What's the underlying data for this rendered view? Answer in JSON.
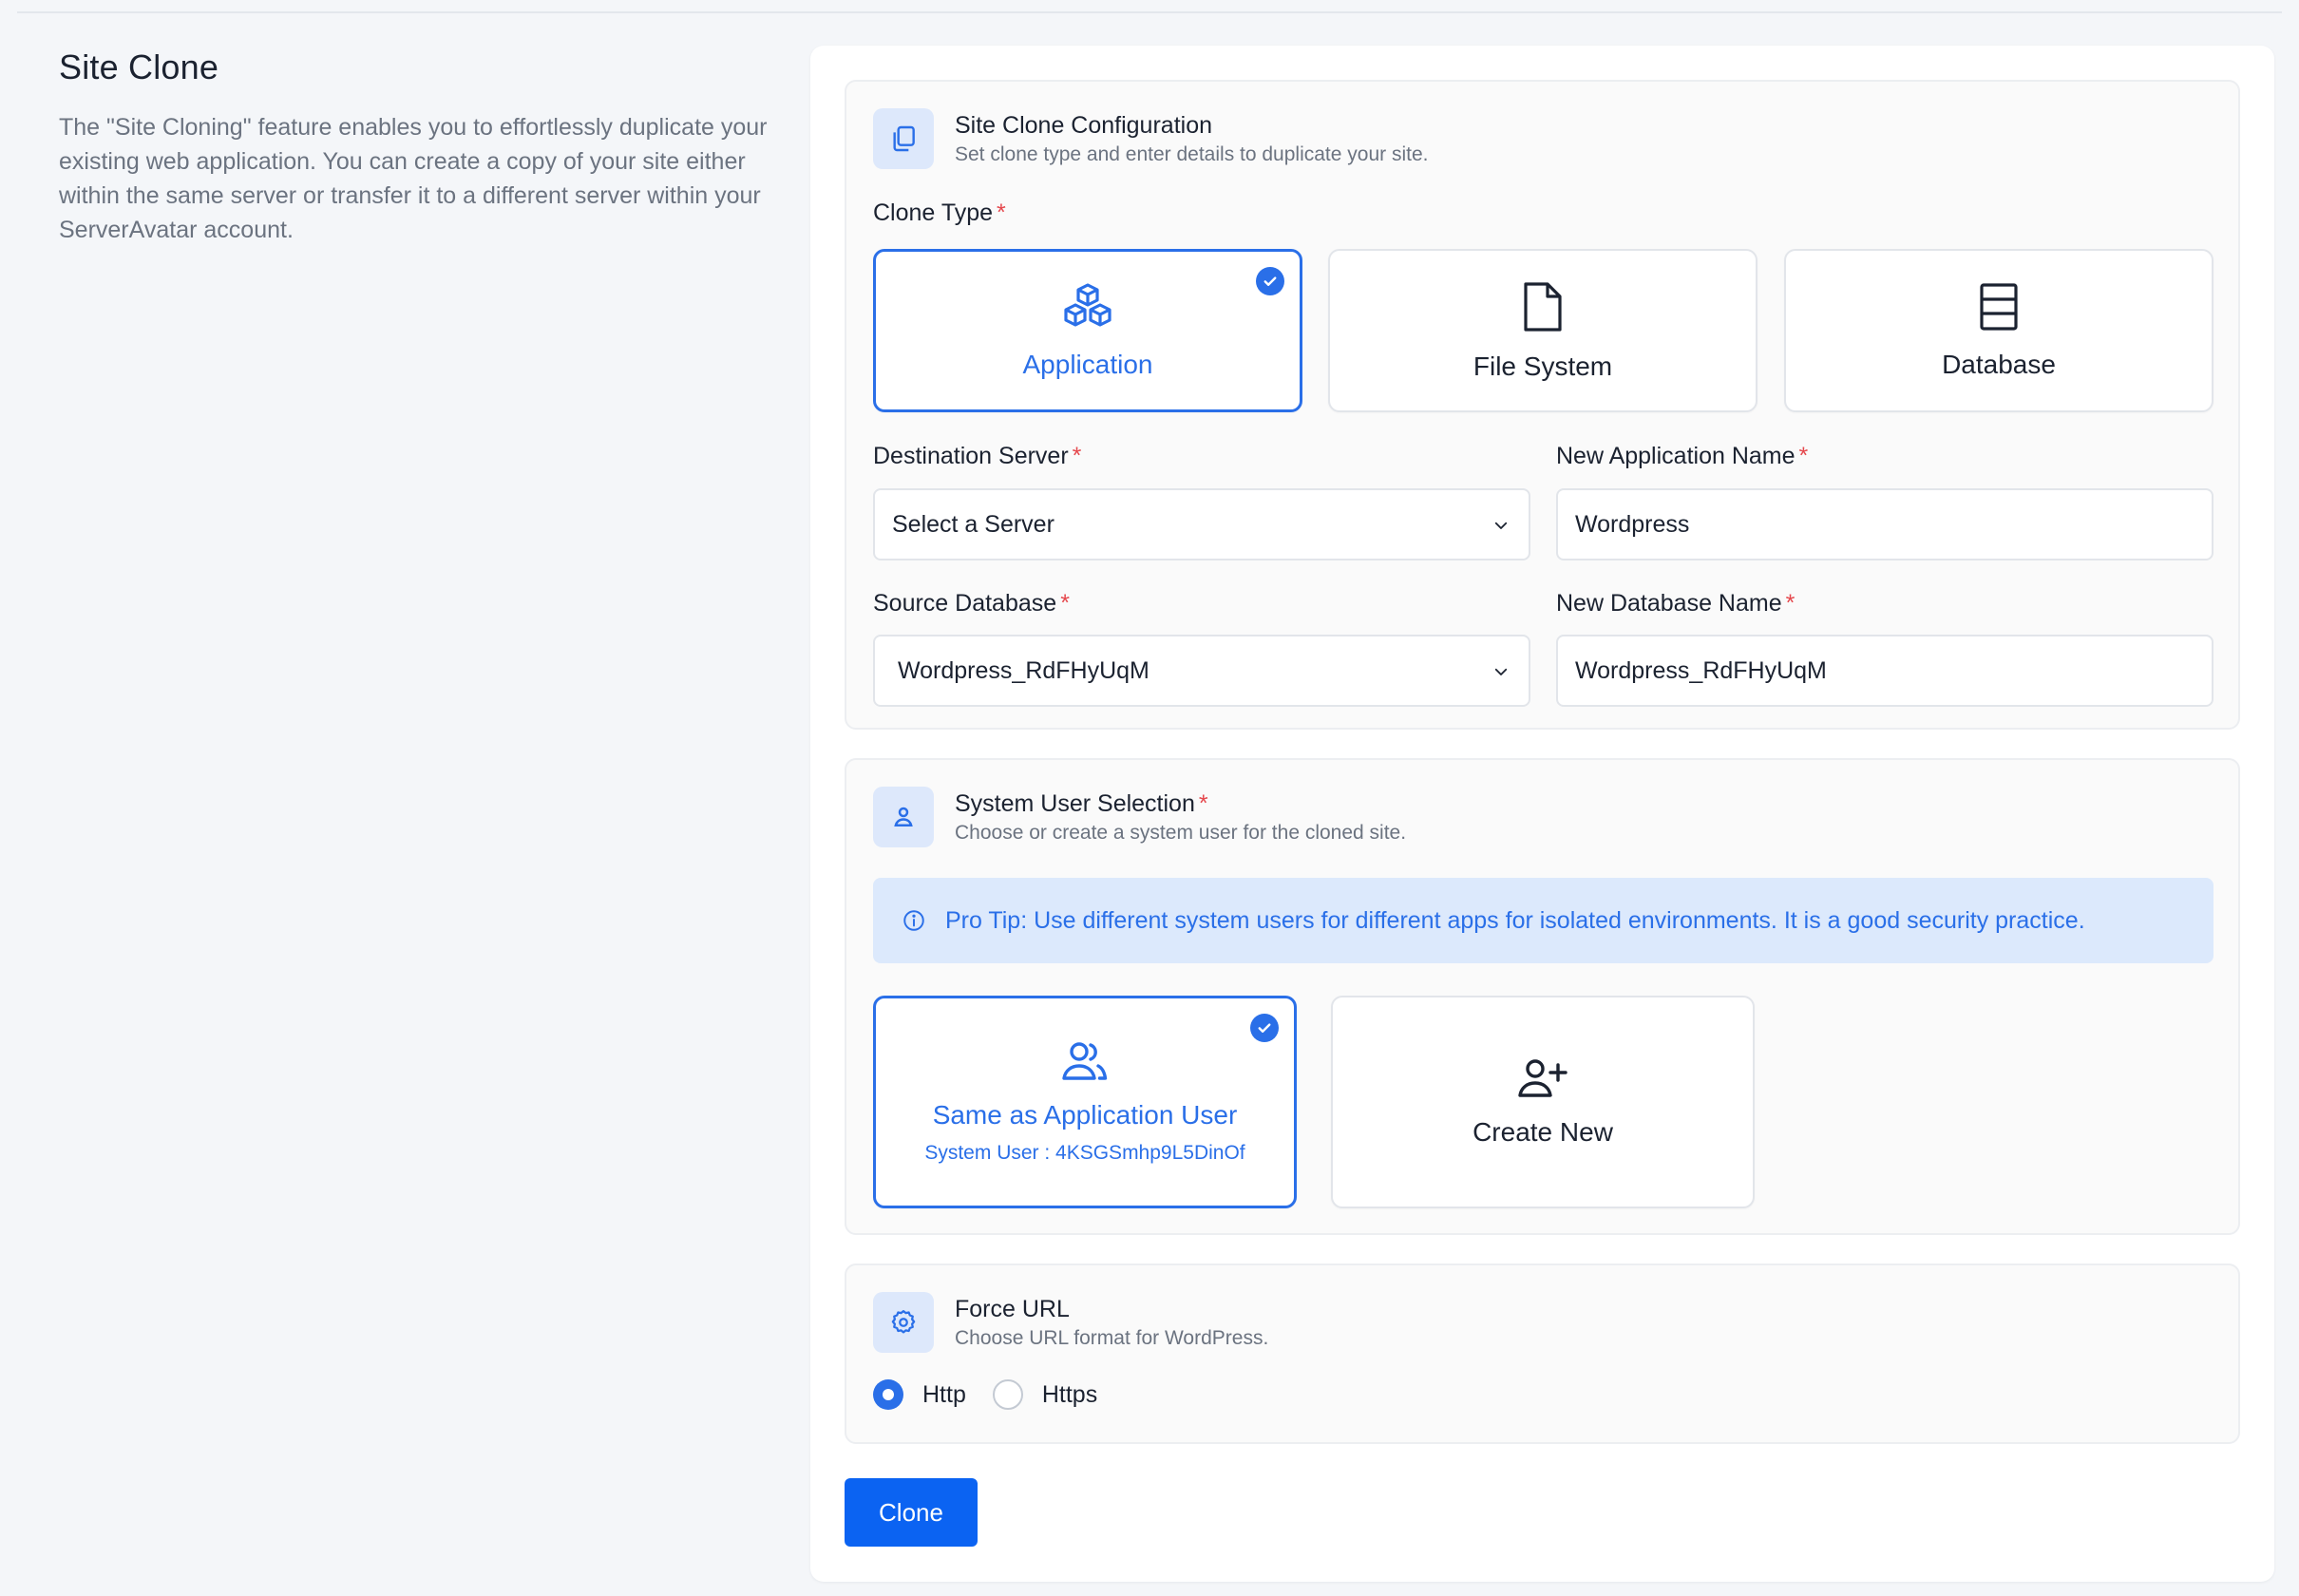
{
  "intro": {
    "title": "Site Clone",
    "description": "The \"Site Cloning\" feature enables you to effortlessly duplicate your existing web application. You can create a copy of your site either within the same server or transfer it to a different server within your ServerAvatar account."
  },
  "config": {
    "title": "Site Clone Configuration",
    "subtitle": "Set clone type and enter details to duplicate your site.",
    "clone_type_label": "Clone Type",
    "clone_types": [
      {
        "label": "Application",
        "icon": "boxes-icon",
        "selected": true
      },
      {
        "label": "File System",
        "icon": "file-icon",
        "selected": false
      },
      {
        "label": "Database",
        "icon": "database-icon",
        "selected": false
      }
    ],
    "destination_server_label": "Destination Server",
    "destination_server_value": "Select a Server",
    "new_app_name_label": "New Application Name",
    "new_app_name_value": "Wordpress",
    "source_db_label": "Source Database",
    "source_db_value": "Wordpress_RdFHyUqM",
    "new_db_name_label": "New Database Name",
    "new_db_name_value": "Wordpress_RdFHyUqM",
    "required_mark": "*"
  },
  "system_user": {
    "title": "System User Selection",
    "subtitle": "Choose or create a system user for the cloned site.",
    "tip": "Pro Tip: Use different system users for different apps for isolated environments. It is a good security practice.",
    "options": [
      {
        "label": "Same as Application User",
        "sub": "System User : 4KSGSmhp9L5DinOf",
        "icon": "users-icon",
        "selected": true
      },
      {
        "label": "Create New",
        "icon": "user-plus-icon",
        "selected": false
      }
    ]
  },
  "force_url": {
    "title": "Force URL",
    "subtitle": "Choose URL format for WordPress.",
    "options": [
      {
        "label": "Http",
        "selected": true
      },
      {
        "label": "Https",
        "selected": false
      }
    ]
  },
  "actions": {
    "clone_label": "Clone"
  },
  "colors": {
    "accent": "#2a6fe8",
    "button": "#0b63f2",
    "required": "#e5484d",
    "tip_bg": "#dce9fc"
  }
}
